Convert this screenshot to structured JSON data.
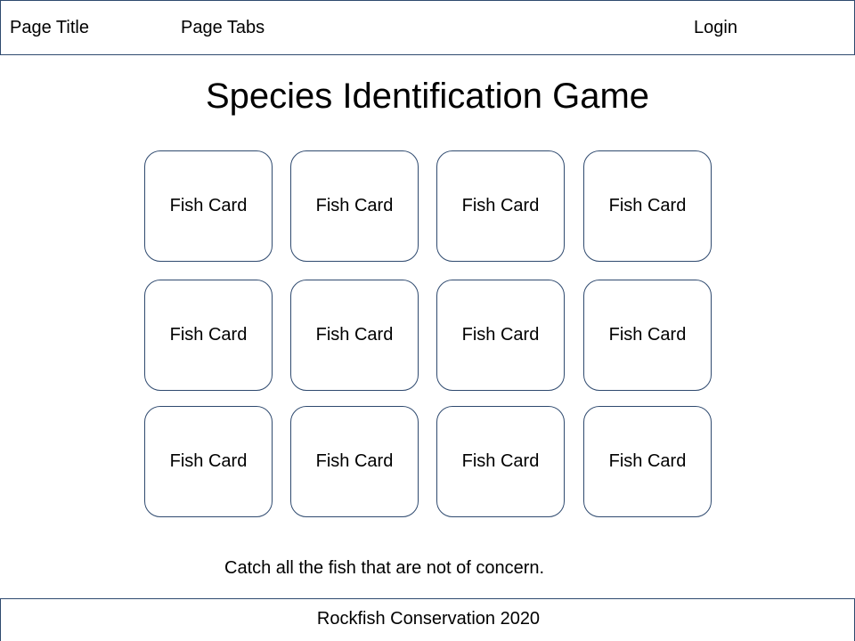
{
  "header": {
    "page_title": "Page Title",
    "page_tabs": "Page Tabs",
    "login": "Login"
  },
  "main": {
    "title": "Species Identification Game",
    "cards": [
      {
        "label": "Fish Card"
      },
      {
        "label": "Fish Card"
      },
      {
        "label": "Fish Card"
      },
      {
        "label": "Fish Card"
      },
      {
        "label": "Fish Card"
      },
      {
        "label": "Fish Card"
      },
      {
        "label": "Fish Card"
      },
      {
        "label": "Fish Card"
      },
      {
        "label": "Fish Card"
      },
      {
        "label": "Fish Card"
      },
      {
        "label": "Fish Card"
      },
      {
        "label": "Fish Card"
      }
    ],
    "instructions": "Catch all the fish that are not of concern."
  },
  "footer": {
    "text": "Rockfish Conservation 2020"
  },
  "colors": {
    "border": "#2f4a6f",
    "background": "#ffffff",
    "text": "#000000"
  }
}
